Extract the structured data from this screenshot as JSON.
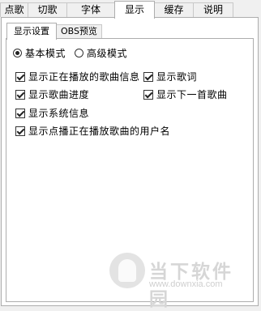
{
  "top_tabs": [
    "点歌",
    "切歌",
    "字体",
    "显示",
    "缓存",
    "说明"
  ],
  "active_top_tab": "显示",
  "sub_tabs": [
    "显示设置",
    "OBS预览"
  ],
  "active_sub_tab": "显示设置",
  "mode": {
    "basic_label": "基本模式",
    "advanced_label": "高级模式",
    "selected": "basic"
  },
  "options": {
    "show_playing_song": {
      "label": "显示正在播放的歌曲信息",
      "checked": true
    },
    "show_lyrics": {
      "label": "显示歌词",
      "checked": true
    },
    "show_progress": {
      "label": "显示歌曲进度",
      "checked": true
    },
    "show_next_song": {
      "label": "显示下一首歌曲",
      "checked": true
    },
    "show_system_info": {
      "label": "显示系统信息",
      "checked": true
    },
    "show_requester": {
      "label": "显示点播正在播放歌曲的用户名",
      "checked": true
    }
  },
  "watermark": {
    "title": "当下软件园",
    "url": "www.downxia.com"
  }
}
